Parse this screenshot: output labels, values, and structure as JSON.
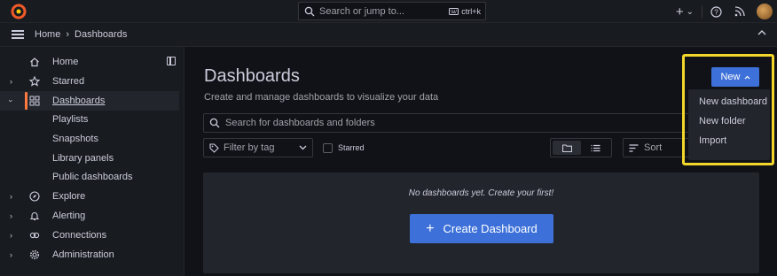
{
  "search_top": {
    "placeholder": "Search or jump to...",
    "shortcut": "ctrl+k"
  },
  "topbar": {
    "plus": "+",
    "chevron": "⌄"
  },
  "breadcrumb": {
    "home": "Home",
    "separator": "›",
    "current": "Dashboards"
  },
  "sidebar": {
    "items": [
      {
        "label": "Home",
        "icon": "home-icon"
      },
      {
        "label": "Starred",
        "icon": "star-icon"
      },
      {
        "label": "Dashboards",
        "icon": "dashboards-icon"
      },
      {
        "label": "Explore",
        "icon": "compass-icon"
      },
      {
        "label": "Alerting",
        "icon": "bell-icon"
      },
      {
        "label": "Connections",
        "icon": "connections-icon"
      },
      {
        "label": "Administration",
        "icon": "gear-icon"
      }
    ],
    "sub_items": [
      "Playlists",
      "Snapshots",
      "Library panels",
      "Public dashboards"
    ]
  },
  "main": {
    "title": "Dashboards",
    "subtitle": "Create and manage dashboards to visualize your data",
    "search_placeholder": "Search for dashboards and folders",
    "filter_tag": "Filter by tag",
    "starred_label": "Starred",
    "sort_label": "Sort",
    "empty_message": "No dashboards yet. Create your first!",
    "create_button": "Create Dashboard",
    "create_icon": "+"
  },
  "new_menu": {
    "button": "New",
    "items": [
      "New dashboard",
      "New folder",
      "Import"
    ]
  },
  "colors": {
    "accent": "#3d71d9",
    "active_bar": "#ff7941",
    "highlight": "#f2d62b",
    "background": "#111217",
    "panel": "#181b1f"
  }
}
